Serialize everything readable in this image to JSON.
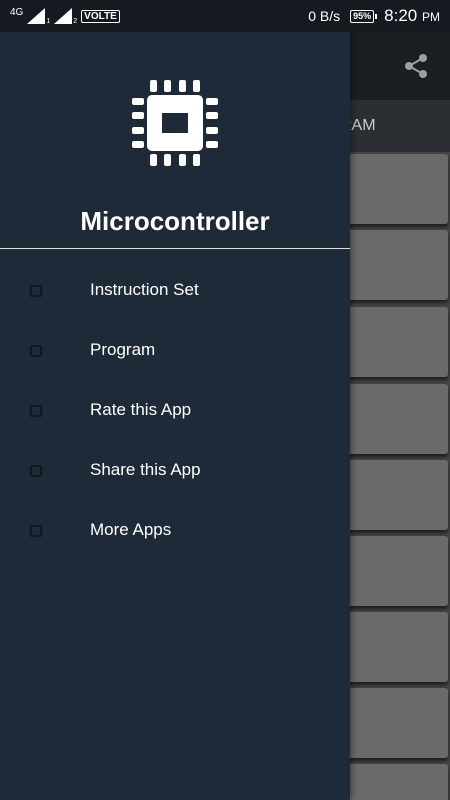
{
  "status_bar": {
    "network": "4G",
    "sim1": "1",
    "sim2": "2",
    "volte": "VOLTE",
    "data_speed": "0 B/s",
    "battery": "95%",
    "time": "8:20",
    "ampm": "PM"
  },
  "background_app": {
    "tab_label": "RAM",
    "share_icon": "share-icon"
  },
  "drawer": {
    "logo_icon": "microchip-icon",
    "title": "Microcontroller",
    "items": [
      {
        "label": "Instruction Set",
        "icon": "microchip-icon"
      },
      {
        "label": "Program",
        "icon": "microchip-icon"
      },
      {
        "label": "Rate this App",
        "icon": "microchip-icon"
      },
      {
        "label": "Share this App",
        "icon": "microchip-icon"
      },
      {
        "label": "More Apps",
        "icon": "microchip-icon"
      }
    ]
  },
  "colors": {
    "drawer_bg": "#1f2a38",
    "status_bar_bg": "#151a20",
    "text": "#ffffff",
    "card_bg": "#6a6a6a"
  }
}
